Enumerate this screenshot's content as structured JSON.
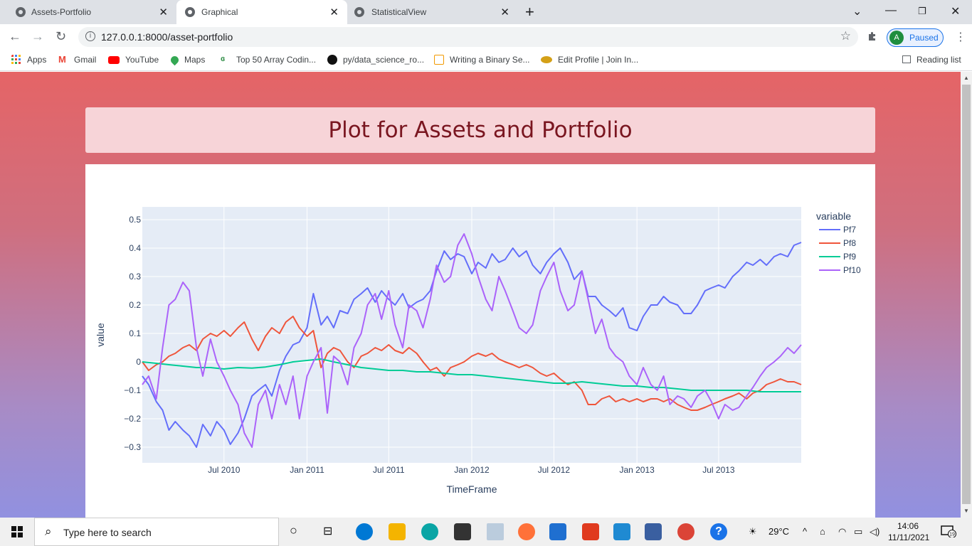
{
  "browser": {
    "tabs": [
      {
        "label": "Assets-Portfolio",
        "active": false
      },
      {
        "label": "Graphical",
        "active": true
      },
      {
        "label": "StatisticalView",
        "active": false
      }
    ],
    "url": "127.0.0.1:8000/asset-portfolio",
    "profile_initial": "A",
    "profile_status": "Paused",
    "bookmarks": [
      {
        "label": "Apps",
        "icon": "apps-grid-icon",
        "color": "#ea4335"
      },
      {
        "label": "Gmail",
        "icon": "gmail-icon",
        "color": "#ea4335"
      },
      {
        "label": "YouTube",
        "icon": "youtube-icon",
        "color": "#ff0000"
      },
      {
        "label": "Maps",
        "icon": "maps-pin-icon",
        "color": "#34a853"
      },
      {
        "label": "Top 50 Array Codin...",
        "icon": "gfg-icon",
        "color": "#2f8d46"
      },
      {
        "label": "py/data_science_ro...",
        "icon": "github-icon",
        "color": "#111111"
      },
      {
        "label": "Writing a Binary Se...",
        "icon": "binary-search-icon",
        "color": "#f29900"
      },
      {
        "label": "Edit Profile | Join In...",
        "icon": "joinin-icon",
        "color": "#c08a00"
      }
    ],
    "reading_list": "Reading list"
  },
  "page": {
    "title": "Plot for Assets and Portfolio"
  },
  "chart_data": {
    "type": "line",
    "title": "",
    "xlabel": "TimeFrame",
    "ylabel": "value",
    "legend_title": "variable",
    "legend_position": "top-right",
    "grid": true,
    "x_range": [
      "2010-01-01",
      "2013-12-31"
    ],
    "ylim": [
      -0.355,
      0.545
    ],
    "y_ticks": [
      0.5,
      0.4,
      0.3,
      0.2,
      0.1,
      0,
      -0.1,
      -0.2,
      -0.3
    ],
    "y_tick_labels": [
      "0.5",
      "0.4",
      "0.3",
      "0.2",
      "0.1",
      "0",
      "−0.1",
      "−0.2",
      "−0.3"
    ],
    "x_ticks": [
      "2010-07-01",
      "2011-01-01",
      "2011-07-01",
      "2012-01-01",
      "2012-07-01",
      "2013-01-01",
      "2013-07-01"
    ],
    "x_tick_labels": [
      "Jul 2010",
      "Jan 2011",
      "Jul 2011",
      "Jan 2012",
      "Jul 2012",
      "Jan 2013",
      "Jul 2013"
    ],
    "series": [
      {
        "name": "Pf7",
        "color": "#636efa",
        "x": [
          "2010-01-01",
          "2010-01-15",
          "2010-02-01",
          "2010-02-15",
          "2010-03-01",
          "2010-03-15",
          "2010-04-01",
          "2010-04-15",
          "2010-05-01",
          "2010-05-15",
          "2010-06-01",
          "2010-06-15",
          "2010-07-01",
          "2010-07-15",
          "2010-08-01",
          "2010-08-15",
          "2010-09-01",
          "2010-09-15",
          "2010-10-01",
          "2010-10-15",
          "2010-11-01",
          "2010-11-15",
          "2010-12-01",
          "2010-12-15",
          "2011-01-01",
          "2011-01-15",
          "2011-02-01",
          "2011-02-15",
          "2011-03-01",
          "2011-03-15",
          "2011-04-01",
          "2011-04-15",
          "2011-05-01",
          "2011-05-15",
          "2011-06-01",
          "2011-06-15",
          "2011-07-01",
          "2011-07-15",
          "2011-08-01",
          "2011-08-15",
          "2011-09-01",
          "2011-09-15",
          "2011-10-01",
          "2011-10-15",
          "2011-11-01",
          "2011-11-15",
          "2011-12-01",
          "2011-12-15",
          "2012-01-01",
          "2012-01-15",
          "2012-02-01",
          "2012-02-15",
          "2012-03-01",
          "2012-03-15",
          "2012-04-01",
          "2012-04-15",
          "2012-05-01",
          "2012-05-15",
          "2012-06-01",
          "2012-06-15",
          "2012-07-01",
          "2012-07-15",
          "2012-08-01",
          "2012-08-15",
          "2012-09-01",
          "2012-09-15",
          "2012-10-01",
          "2012-10-15",
          "2012-11-01",
          "2012-11-15",
          "2012-12-01",
          "2012-12-15",
          "2013-01-01",
          "2013-01-15",
          "2013-02-01",
          "2013-02-15",
          "2013-03-01",
          "2013-03-15",
          "2013-04-01",
          "2013-04-15",
          "2013-05-01",
          "2013-05-15",
          "2013-06-01",
          "2013-06-15",
          "2013-07-01",
          "2013-07-15",
          "2013-08-01",
          "2013-08-15",
          "2013-09-01",
          "2013-09-15",
          "2013-10-01",
          "2013-10-15",
          "2013-11-01",
          "2013-11-15",
          "2013-12-01",
          "2013-12-15",
          "2013-12-31"
        ],
        "y": [
          -0.05,
          -0.08,
          -0.14,
          -0.17,
          -0.24,
          -0.21,
          -0.24,
          -0.26,
          -0.3,
          -0.22,
          -0.26,
          -0.21,
          -0.24,
          -0.29,
          -0.25,
          -0.2,
          -0.12,
          -0.1,
          -0.08,
          -0.12,
          -0.03,
          0.02,
          0.06,
          0.07,
          0.12,
          0.24,
          0.13,
          0.16,
          0.12,
          0.18,
          0.17,
          0.22,
          0.24,
          0.26,
          0.21,
          0.25,
          0.22,
          0.2,
          0.24,
          0.19,
          0.21,
          0.22,
          0.25,
          0.32,
          0.39,
          0.36,
          0.38,
          0.37,
          0.31,
          0.35,
          0.33,
          0.38,
          0.35,
          0.36,
          0.4,
          0.37,
          0.39,
          0.34,
          0.31,
          0.35,
          0.38,
          0.4,
          0.35,
          0.29,
          0.32,
          0.23,
          0.23,
          0.2,
          0.18,
          0.16,
          0.19,
          0.12,
          0.11,
          0.16,
          0.2,
          0.2,
          0.23,
          0.21,
          0.2,
          0.17,
          0.17,
          0.2,
          0.25,
          0.26,
          0.27,
          0.26,
          0.3,
          0.32,
          0.35,
          0.34,
          0.36,
          0.34,
          0.37,
          0.38,
          0.37,
          0.41,
          0.42
        ]
      },
      {
        "name": "Pf8",
        "color": "#ef553b",
        "x": [
          "2010-01-01",
          "2010-01-15",
          "2010-02-01",
          "2010-02-15",
          "2010-03-01",
          "2010-03-15",
          "2010-04-01",
          "2010-04-15",
          "2010-05-01",
          "2010-05-15",
          "2010-06-01",
          "2010-06-15",
          "2010-07-01",
          "2010-07-15",
          "2010-08-01",
          "2010-08-15",
          "2010-09-01",
          "2010-09-15",
          "2010-10-01",
          "2010-10-15",
          "2010-11-01",
          "2010-11-15",
          "2010-12-01",
          "2010-12-15",
          "2011-01-01",
          "2011-01-15",
          "2011-02-01",
          "2011-02-15",
          "2011-03-01",
          "2011-03-15",
          "2011-04-01",
          "2011-04-15",
          "2011-05-01",
          "2011-05-15",
          "2011-06-01",
          "2011-06-15",
          "2011-07-01",
          "2011-07-15",
          "2011-08-01",
          "2011-08-15",
          "2011-09-01",
          "2011-09-15",
          "2011-10-01",
          "2011-10-15",
          "2011-11-01",
          "2011-11-15",
          "2011-12-01",
          "2011-12-15",
          "2012-01-01",
          "2012-01-15",
          "2012-02-01",
          "2012-02-15",
          "2012-03-01",
          "2012-03-15",
          "2012-04-01",
          "2012-04-15",
          "2012-05-01",
          "2012-05-15",
          "2012-06-01",
          "2012-06-15",
          "2012-07-01",
          "2012-07-15",
          "2012-08-01",
          "2012-08-15",
          "2012-09-01",
          "2012-09-15",
          "2012-10-01",
          "2012-10-15",
          "2012-11-01",
          "2012-11-15",
          "2012-12-01",
          "2012-12-15",
          "2013-01-01",
          "2013-01-15",
          "2013-02-01",
          "2013-02-15",
          "2013-03-01",
          "2013-03-15",
          "2013-04-01",
          "2013-04-15",
          "2013-05-01",
          "2013-05-15",
          "2013-06-01",
          "2013-06-15",
          "2013-07-01",
          "2013-07-15",
          "2013-08-01",
          "2013-08-15",
          "2013-09-01",
          "2013-09-15",
          "2013-10-01",
          "2013-10-15",
          "2013-11-01",
          "2013-11-15",
          "2013-12-01",
          "2013-12-15",
          "2013-12-31"
        ],
        "y": [
          0.0,
          -0.03,
          -0.01,
          0.0,
          0.02,
          0.03,
          0.05,
          0.06,
          0.04,
          0.08,
          0.1,
          0.09,
          0.11,
          0.09,
          0.12,
          0.14,
          0.08,
          0.04,
          0.09,
          0.12,
          0.1,
          0.14,
          0.16,
          0.12,
          0.09,
          0.11,
          -0.02,
          0.03,
          0.05,
          0.04,
          0.0,
          -0.02,
          0.02,
          0.03,
          0.05,
          0.04,
          0.06,
          0.04,
          0.03,
          0.05,
          0.03,
          0.0,
          -0.03,
          -0.02,
          -0.05,
          -0.02,
          -0.01,
          0.0,
          0.02,
          0.03,
          0.02,
          0.03,
          0.01,
          0.0,
          -0.01,
          -0.02,
          -0.01,
          -0.02,
          -0.04,
          -0.05,
          -0.04,
          -0.06,
          -0.08,
          -0.07,
          -0.1,
          -0.15,
          -0.15,
          -0.13,
          -0.12,
          -0.14,
          -0.13,
          -0.14,
          -0.13,
          -0.14,
          -0.13,
          -0.13,
          -0.14,
          -0.13,
          -0.15,
          -0.16,
          -0.17,
          -0.17,
          -0.16,
          -0.15,
          -0.14,
          -0.13,
          -0.12,
          -0.11,
          -0.13,
          -0.11,
          -0.1,
          -0.08,
          -0.07,
          -0.06,
          -0.07,
          -0.07,
          -0.08
        ]
      },
      {
        "name": "Pf9",
        "color": "#00cc96",
        "x": [
          "2010-01-01",
          "2010-02-01",
          "2010-03-01",
          "2010-04-01",
          "2010-05-01",
          "2010-06-01",
          "2010-07-01",
          "2010-08-01",
          "2010-09-01",
          "2010-10-01",
          "2010-11-01",
          "2010-12-01",
          "2011-01-01",
          "2011-02-01",
          "2011-03-01",
          "2011-04-01",
          "2011-05-01",
          "2011-06-01",
          "2011-07-01",
          "2011-08-01",
          "2011-09-01",
          "2011-10-01",
          "2011-11-01",
          "2011-12-01",
          "2012-01-01",
          "2012-02-01",
          "2012-03-01",
          "2012-04-01",
          "2012-05-01",
          "2012-06-01",
          "2012-07-01",
          "2012-08-01",
          "2012-09-01",
          "2012-10-01",
          "2012-11-01",
          "2012-12-01",
          "2013-01-01",
          "2013-02-01",
          "2013-03-01",
          "2013-04-01",
          "2013-05-01",
          "2013-06-01",
          "2013-07-01",
          "2013-08-01",
          "2013-09-01",
          "2013-10-01",
          "2013-11-01",
          "2013-12-01",
          "2013-12-31"
        ],
        "y": [
          0.0,
          -0.005,
          -0.01,
          -0.015,
          -0.02,
          -0.02,
          -0.025,
          -0.02,
          -0.022,
          -0.018,
          -0.01,
          0.0,
          0.005,
          0.01,
          0.0,
          -0.01,
          -0.02,
          -0.025,
          -0.03,
          -0.03,
          -0.035,
          -0.035,
          -0.04,
          -0.045,
          -0.045,
          -0.05,
          -0.055,
          -0.06,
          -0.065,
          -0.07,
          -0.075,
          -0.075,
          -0.07,
          -0.075,
          -0.08,
          -0.085,
          -0.085,
          -0.09,
          -0.09,
          -0.095,
          -0.1,
          -0.1,
          -0.1,
          -0.1,
          -0.1,
          -0.105,
          -0.105,
          -0.105,
          -0.105
        ]
      },
      {
        "name": "Pf10",
        "color": "#ab63fa",
        "x": [
          "2010-01-01",
          "2010-01-15",
          "2010-02-01",
          "2010-02-15",
          "2010-03-01",
          "2010-03-15",
          "2010-04-01",
          "2010-04-15",
          "2010-05-01",
          "2010-05-15",
          "2010-06-01",
          "2010-06-15",
          "2010-07-01",
          "2010-07-15",
          "2010-08-01",
          "2010-08-15",
          "2010-09-01",
          "2010-09-15",
          "2010-10-01",
          "2010-10-15",
          "2010-11-01",
          "2010-11-15",
          "2010-12-01",
          "2010-12-15",
          "2011-01-01",
          "2011-01-15",
          "2011-02-01",
          "2011-02-15",
          "2011-03-01",
          "2011-03-15",
          "2011-04-01",
          "2011-04-15",
          "2011-05-01",
          "2011-05-15",
          "2011-06-01",
          "2011-06-15",
          "2011-07-01",
          "2011-07-15",
          "2011-08-01",
          "2011-08-15",
          "2011-09-01",
          "2011-09-15",
          "2011-10-01",
          "2011-10-15",
          "2011-11-01",
          "2011-11-15",
          "2011-12-01",
          "2011-12-15",
          "2012-01-01",
          "2012-01-15",
          "2012-02-01",
          "2012-02-15",
          "2012-03-01",
          "2012-03-15",
          "2012-04-01",
          "2012-04-15",
          "2012-05-01",
          "2012-05-15",
          "2012-06-01",
          "2012-06-15",
          "2012-07-01",
          "2012-07-15",
          "2012-08-01",
          "2012-08-15",
          "2012-09-01",
          "2012-09-15",
          "2012-10-01",
          "2012-10-15",
          "2012-11-01",
          "2012-11-15",
          "2012-12-01",
          "2012-12-15",
          "2013-01-01",
          "2013-01-15",
          "2013-02-01",
          "2013-02-15",
          "2013-03-01",
          "2013-03-15",
          "2013-04-01",
          "2013-04-15",
          "2013-05-01",
          "2013-05-15",
          "2013-06-01",
          "2013-06-15",
          "2013-07-01",
          "2013-07-15",
          "2013-08-01",
          "2013-08-15",
          "2013-09-01",
          "2013-09-15",
          "2013-10-01",
          "2013-10-15",
          "2013-11-01",
          "2013-11-15",
          "2013-12-01",
          "2013-12-15",
          "2013-12-31"
        ],
        "y": [
          -0.08,
          -0.05,
          -0.13,
          0.05,
          0.2,
          0.22,
          0.28,
          0.25,
          0.05,
          -0.05,
          0.08,
          0.0,
          -0.05,
          -0.1,
          -0.15,
          -0.25,
          -0.3,
          -0.15,
          -0.1,
          -0.2,
          -0.08,
          -0.15,
          -0.05,
          -0.2,
          -0.05,
          0.0,
          0.05,
          -0.18,
          0.02,
          0.0,
          -0.08,
          0.05,
          0.1,
          0.2,
          0.24,
          0.15,
          0.25,
          0.13,
          0.05,
          0.2,
          0.18,
          0.12,
          0.22,
          0.34,
          0.28,
          0.3,
          0.41,
          0.45,
          0.38,
          0.3,
          0.22,
          0.18,
          0.3,
          0.25,
          0.18,
          0.12,
          0.1,
          0.13,
          0.25,
          0.3,
          0.35,
          0.25,
          0.18,
          0.2,
          0.32,
          0.22,
          0.1,
          0.15,
          0.05,
          0.02,
          0.0,
          -0.05,
          -0.08,
          -0.02,
          -0.08,
          -0.1,
          -0.05,
          -0.15,
          -0.12,
          -0.13,
          -0.16,
          -0.12,
          -0.1,
          -0.14,
          -0.2,
          -0.15,
          -0.17,
          -0.16,
          -0.12,
          -0.09,
          -0.05,
          -0.02,
          0.0,
          0.02,
          0.05,
          0.03,
          0.06
        ]
      }
    ]
  },
  "taskbar": {
    "search_placeholder": "Type here to search",
    "weather": "29°C",
    "time": "14:06",
    "date": "11/11/2021",
    "notification_count": "19"
  }
}
